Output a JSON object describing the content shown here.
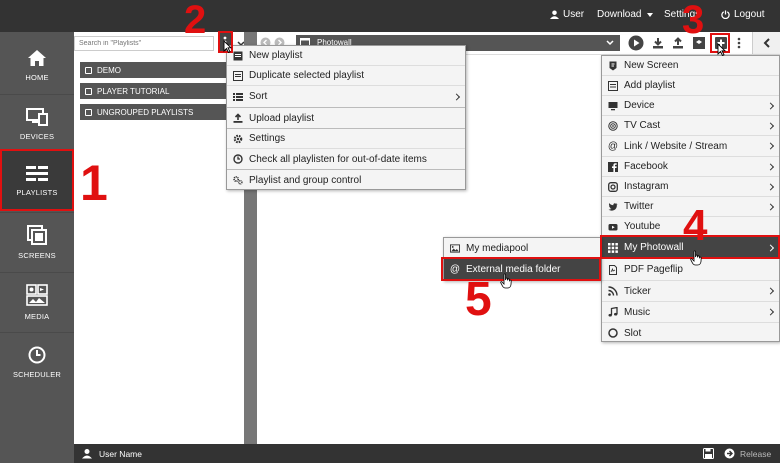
{
  "topbar": {
    "user": "User",
    "download": "Download",
    "settings": "Settings",
    "logout": "Logout"
  },
  "sidebar": {
    "items": [
      {
        "label": "HOME",
        "icon": "home-icon"
      },
      {
        "label": "DEVICES",
        "icon": "devices-icon"
      },
      {
        "label": "PLAYLISTS",
        "icon": "playlists-icon"
      },
      {
        "label": "SCREENS",
        "icon": "screens-icon"
      },
      {
        "label": "MEDIA",
        "icon": "media-icon"
      },
      {
        "label": "SCHEDULER",
        "icon": "clock-icon"
      }
    ]
  },
  "search": {
    "placeholder": "Search in \"Playlists\""
  },
  "playlists": [
    "DEMO",
    "PLAYER TUTORIAL",
    "UNGROUPED PLAYLISTS"
  ],
  "playlist_menu": [
    {
      "label": "New playlist",
      "icon": "new-playlist-icon"
    },
    {
      "label": "Duplicate selected playlist",
      "icon": "duplicate-icon"
    },
    {
      "label": "Sort",
      "icon": "sort-icon",
      "submenu": true
    },
    {
      "label": "Upload playlist",
      "icon": "upload-icon"
    },
    {
      "label": "Settings",
      "icon": "gear-icon"
    },
    {
      "label": "Check all playlisten for out-of-date items",
      "icon": "clock-icon"
    },
    {
      "label": "Playlist and group control",
      "icon": "gears-icon"
    }
  ],
  "photowall": {
    "title": "Photowall"
  },
  "add_menu": [
    {
      "label": "New Screen",
      "icon": "shield-icon"
    },
    {
      "label": "Add playlist",
      "icon": "playlist-icon"
    },
    {
      "label": "Device",
      "icon": "monitor-icon",
      "submenu": true
    },
    {
      "label": "TV Cast",
      "icon": "cast-icon",
      "submenu": true
    },
    {
      "label": "Link / Website / Stream",
      "icon": "at-icon",
      "submenu": true
    },
    {
      "label": "Facebook",
      "icon": "facebook-icon",
      "submenu": true
    },
    {
      "label": "Instagram",
      "icon": "instagram-icon",
      "submenu": true
    },
    {
      "label": "Twitter",
      "icon": "twitter-icon",
      "submenu": true
    },
    {
      "label": "Youtube",
      "icon": "youtube-icon"
    },
    {
      "label": "My Photowall",
      "icon": "grid-icon",
      "submenu": true
    },
    {
      "label": "PDF Pageflip",
      "icon": "pdf-icon"
    },
    {
      "label": "Ticker",
      "icon": "rss-icon",
      "submenu": true
    },
    {
      "label": "Music",
      "icon": "music-icon",
      "submenu": true
    },
    {
      "label": "Slot",
      "icon": "slot-icon"
    }
  ],
  "photowall_menu": [
    {
      "label": "My mediapool",
      "icon": "image-icon"
    },
    {
      "label": "External media folder",
      "icon": "at-icon"
    }
  ],
  "annotations": [
    "1",
    "2",
    "3",
    "4",
    "5"
  ],
  "footer": {
    "user": "User Name",
    "release": "Release"
  },
  "colors": {
    "accent": "#e01010",
    "dark": "#333333",
    "sidebar": "#555555"
  }
}
